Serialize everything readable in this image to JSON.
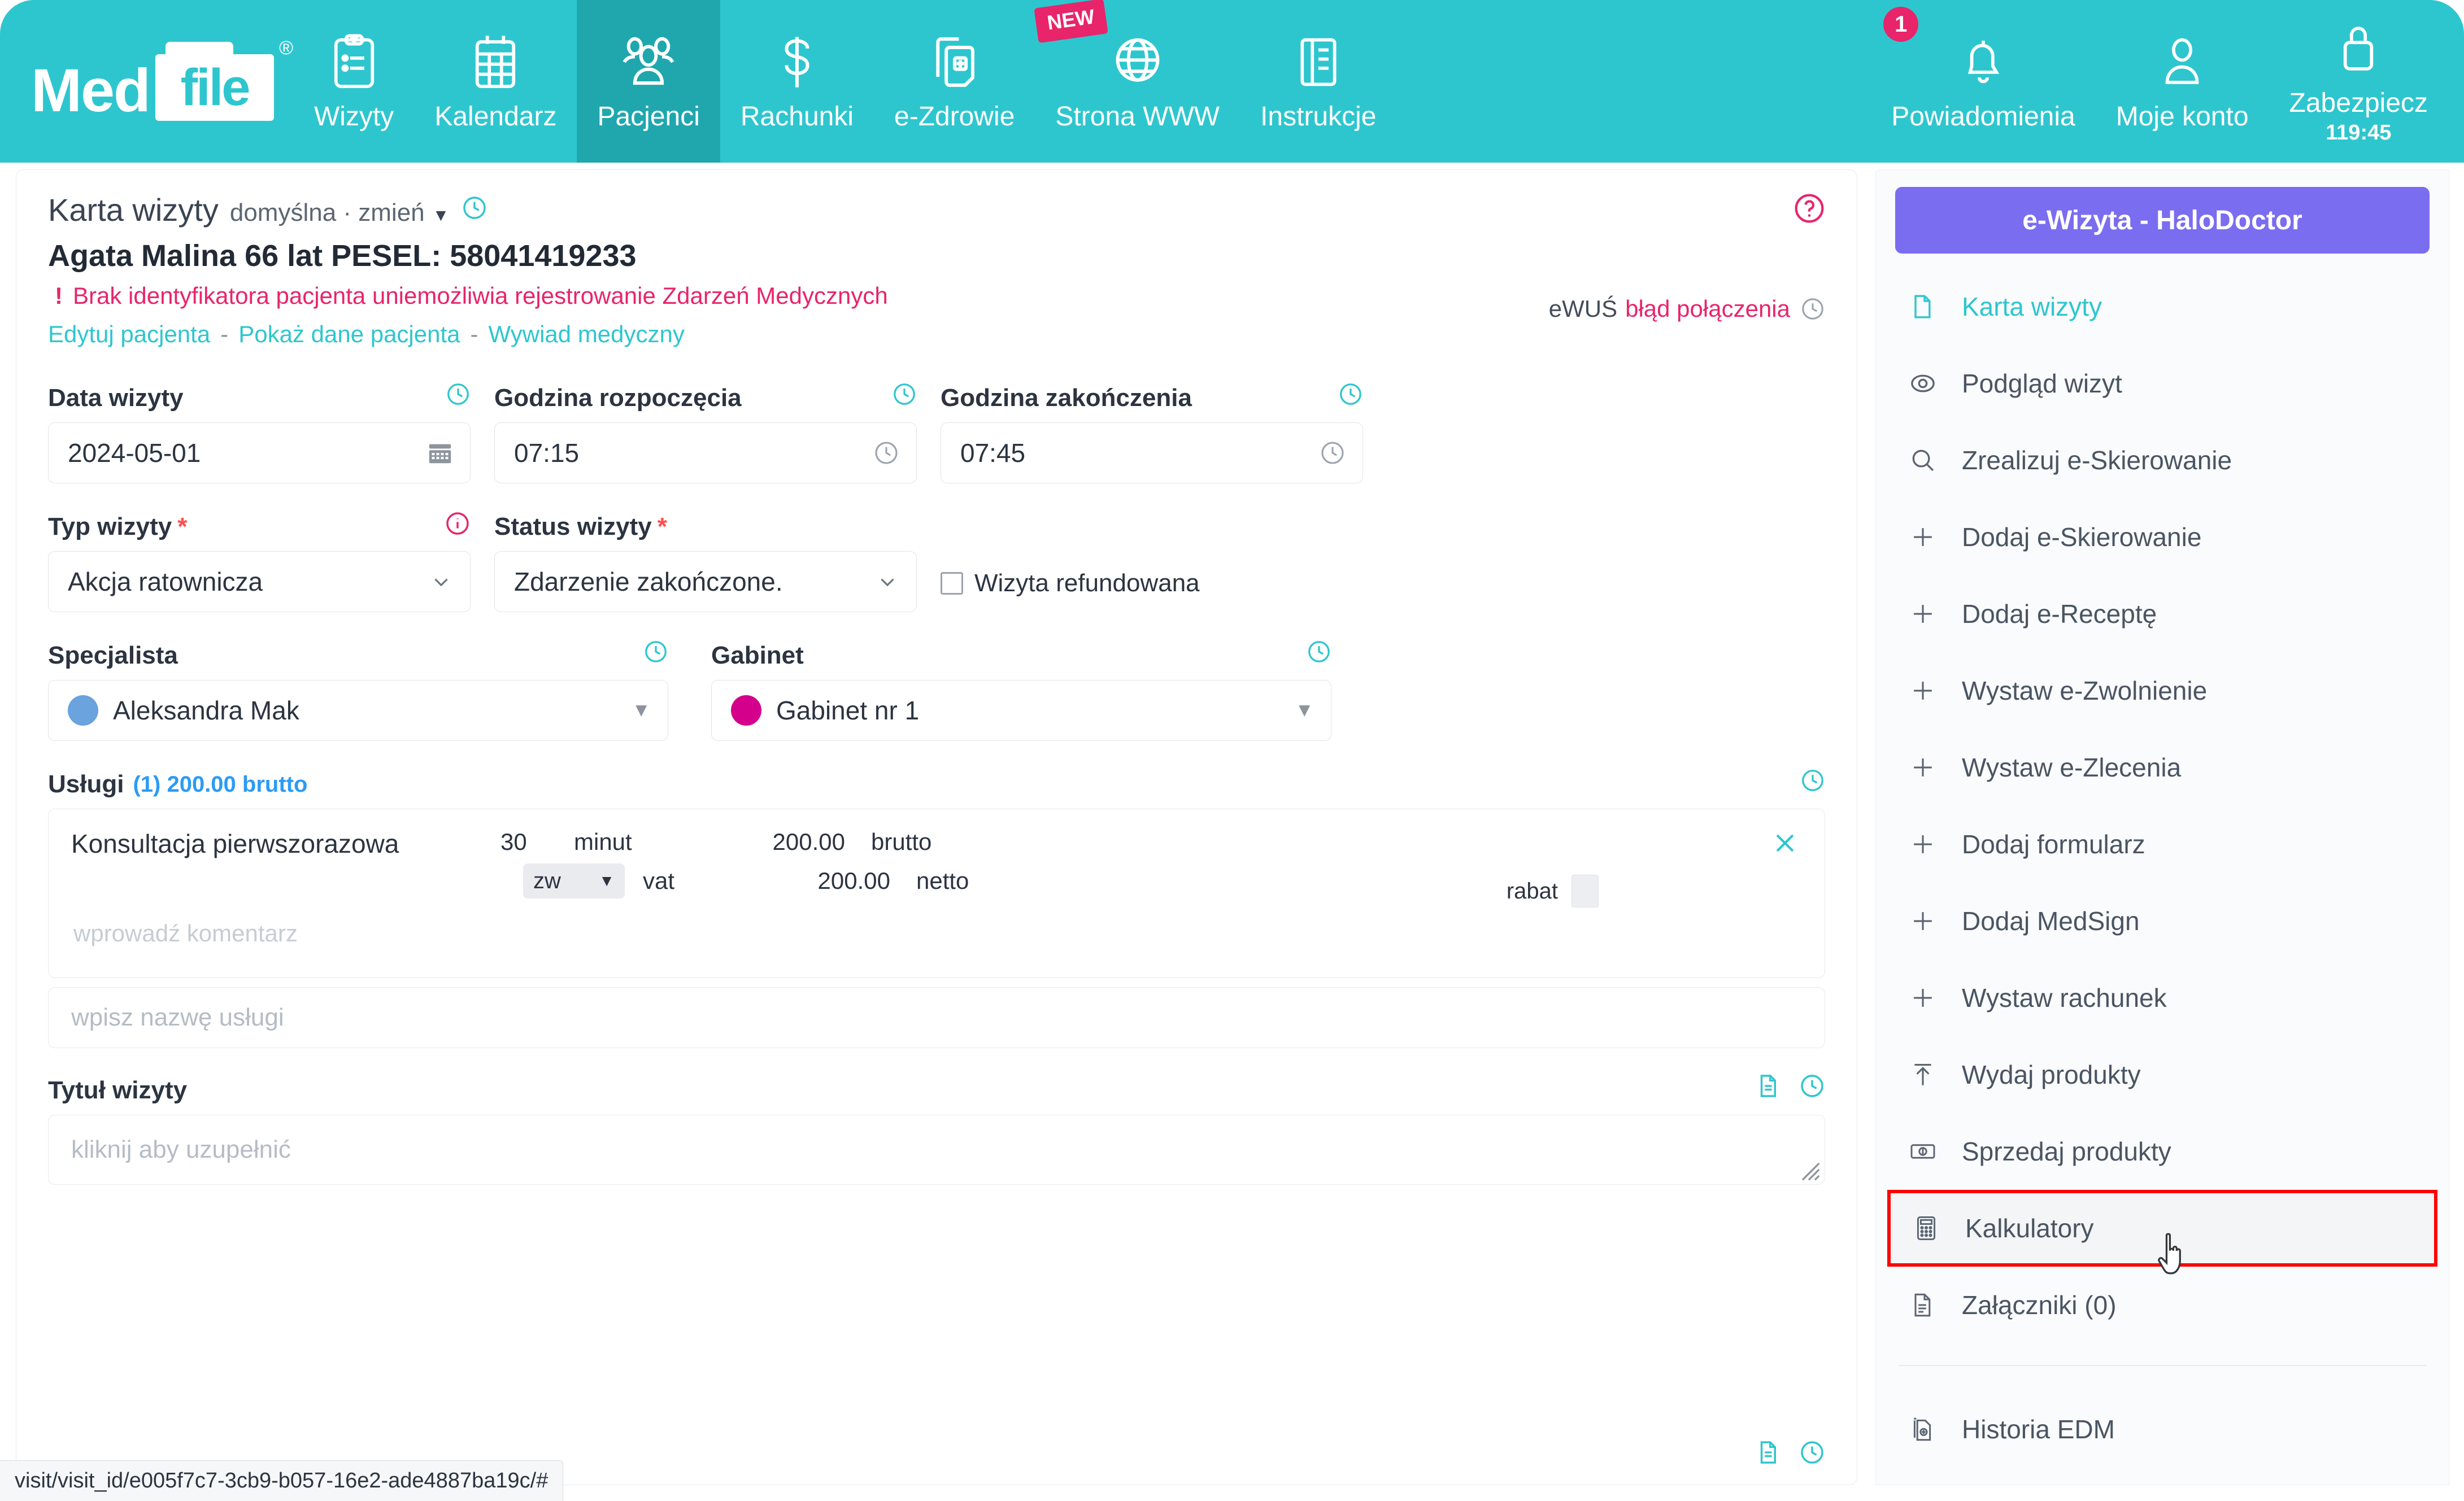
{
  "brand": {
    "med": "Med",
    "file": "file",
    "reg": "®"
  },
  "topnav": {
    "items": [
      {
        "label": "Wizyty",
        "icon": "clipboard-icon",
        "active": false
      },
      {
        "label": "Kalendarz",
        "icon": "calendar-icon",
        "active": false
      },
      {
        "label": "Pacjenci",
        "icon": "patients-icon",
        "active": true
      },
      {
        "label": "Rachunki",
        "icon": "dollar-icon",
        "active": false
      },
      {
        "label": "e-Zdrowie",
        "icon": "medical-card-icon",
        "active": false
      },
      {
        "label": "Strona WWW",
        "icon": "globe-icon",
        "active": false,
        "badge": "NEW"
      },
      {
        "label": "Instrukcje",
        "icon": "book-icon",
        "active": false
      }
    ],
    "right": [
      {
        "label": "Powiadomienia",
        "icon": "bell-icon",
        "count": "1"
      },
      {
        "label": "Moje konto",
        "icon": "user-icon"
      },
      {
        "label": "Zabezpiecz",
        "icon": "lock-icon",
        "sub": "119:45"
      }
    ]
  },
  "card": {
    "title": "Karta wizyty",
    "template_label": "domyślna · zmień",
    "patient": "Agata Malina 66 lat PESEL: 58041419233",
    "warning": "Brak identyfikatora pacjenta uniemożliwia rejestrowanie Zdarzeń Medycznych",
    "warning_mark": "!",
    "links": [
      "Edytuj pacjenta",
      "Pokaż dane pacjenta",
      "Wywiad medyczny"
    ],
    "link_sep": "-",
    "ewus_label": "eWUŚ",
    "ewus_value": "błąd połączenia"
  },
  "form": {
    "date": {
      "label": "Data wizyty",
      "value": "2024-05-01"
    },
    "start": {
      "label": "Godzina rozpoczęcia",
      "value": "07:15"
    },
    "end": {
      "label": "Godzina zakończenia",
      "value": "07:45"
    },
    "type": {
      "label": "Typ wizyty",
      "required": "*",
      "value": "Akcja ratownicza"
    },
    "status": {
      "label": "Status wizyty",
      "required": "*",
      "value": "Zdarzenie zakończone."
    },
    "refunded": {
      "label": "Wizyta refundowana",
      "checked": false
    },
    "specialist": {
      "label": "Specjalista",
      "value": "Aleksandra Mak",
      "dot": "#6aa3dd"
    },
    "room": {
      "label": "Gabinet",
      "value": "Gabinet nr 1",
      "dot": "#d4008c"
    }
  },
  "services": {
    "title": "Usługi",
    "amount": "(1) 200.00 brutto",
    "row": {
      "name": "Konsultacja pierwszorazowa",
      "duration": "30",
      "duration_unit": "minut",
      "gross_value": "200.00",
      "gross_label": "brutto",
      "vat_value": "zw",
      "vat_label": "vat",
      "net_value": "200.00",
      "net_label": "netto",
      "rabat_label": "rabat",
      "comment_placeholder": "wprowadź komentarz"
    },
    "add_placeholder": "wpisz nazwę usługi"
  },
  "visit_title": {
    "label": "Tytuł wizyty",
    "placeholder": "kliknij aby uzupełnić"
  },
  "sidebar": {
    "ewizyta_button": "e-Wizyta - HaloDoctor",
    "items": [
      {
        "label": "Karta wizyty",
        "icon": "document-icon",
        "state": "active"
      },
      {
        "label": "Podgląd wizyt",
        "icon": "eye-icon",
        "state": "normal"
      },
      {
        "label": "Zrealizuj e-Skierowanie",
        "icon": "search-icon",
        "state": "normal"
      },
      {
        "label": "Dodaj e-Skierowanie",
        "icon": "plus-icon",
        "state": "normal"
      },
      {
        "label": "Dodaj e-Receptę",
        "icon": "plus-icon",
        "state": "normal"
      },
      {
        "label": "Wystaw e-Zwolnienie",
        "icon": "plus-icon",
        "state": "normal"
      },
      {
        "label": "Wystaw e-Zlecenia",
        "icon": "plus-icon",
        "state": "normal"
      },
      {
        "label": "Dodaj formularz",
        "icon": "plus-icon",
        "state": "normal"
      },
      {
        "label": "Dodaj MedSign",
        "icon": "plus-icon",
        "state": "normal"
      },
      {
        "label": "Wystaw rachunek",
        "icon": "plus-icon",
        "state": "normal"
      },
      {
        "label": "Wydaj produkty",
        "icon": "upload-icon",
        "state": "normal"
      },
      {
        "label": "Sprzedaj produkty",
        "icon": "banknote-icon",
        "state": "normal"
      },
      {
        "label": "Kalkulatory",
        "icon": "calculator-icon",
        "state": "highlight"
      },
      {
        "label": "Załączniki (0)",
        "icon": "attachment-icon",
        "state": "normal"
      }
    ],
    "footer_item": {
      "label": "Historia EDM",
      "icon": "edm-icon"
    }
  },
  "statusbar": {
    "url": "visit/visit_id/e005f7c7-3cb9-b057-16e2-ade4887ba19c/#"
  },
  "colors": {
    "brand_teal": "#2ec6ce",
    "active_tab": "#20a7ae",
    "accent_pink": "#e8246a",
    "purple": "#7a6df0",
    "highlight_red": "#ff0000",
    "link_blue": "#2b9bf4"
  }
}
